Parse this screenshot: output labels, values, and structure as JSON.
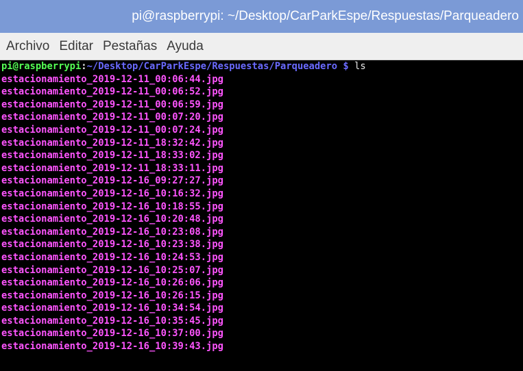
{
  "window": {
    "title": "pi@raspberrypi: ~/Desktop/CarParkEspe/Respuestas/Parqueadero"
  },
  "menu": {
    "items": [
      "Archivo",
      "Editar",
      "Pestañas",
      "Ayuda"
    ]
  },
  "terminal": {
    "prompt_user": "pi@raspberrypi",
    "prompt_colon": ":",
    "prompt_path": "~/Desktop/CarParkEspe/Respuestas/Parqueadero",
    "prompt_symbol": " $ ",
    "command": "ls",
    "files": [
      "estacionamiento_2019-12-11_00:06:44.jpg",
      "estacionamiento_2019-12-11_00:06:52.jpg",
      "estacionamiento_2019-12-11_00:06:59.jpg",
      "estacionamiento_2019-12-11_00:07:20.jpg",
      "estacionamiento_2019-12-11_00:07:24.jpg",
      "estacionamiento_2019-12-11_18:32:42.jpg",
      "estacionamiento_2019-12-11_18:33:02.jpg",
      "estacionamiento_2019-12-11_18:33:11.jpg",
      "estacionamiento_2019-12-16_09:27:27.jpg",
      "estacionamiento_2019-12-16_10:16:32.jpg",
      "estacionamiento_2019-12-16_10:18:55.jpg",
      "estacionamiento_2019-12-16_10:20:48.jpg",
      "estacionamiento_2019-12-16_10:23:08.jpg",
      "estacionamiento_2019-12-16_10:23:38.jpg",
      "estacionamiento_2019-12-16_10:24:53.jpg",
      "estacionamiento_2019-12-16_10:25:07.jpg",
      "estacionamiento_2019-12-16_10:26:06.jpg",
      "estacionamiento_2019-12-16_10:26:15.jpg",
      "estacionamiento_2019-12-16_10:34:54.jpg",
      "estacionamiento_2019-12-16_10:35:45.jpg",
      "estacionamiento_2019-12-16_10:37:00.jpg",
      "estacionamiento_2019-12-16_10:39:43.jpg"
    ]
  },
  "colors": {
    "titlebar_bg": "#7b9ad6",
    "menubar_bg": "#efefef",
    "terminal_bg": "#000000",
    "prompt_user": "#55ff55",
    "prompt_path": "#6a6aff",
    "file_color": "#ff55ff"
  }
}
